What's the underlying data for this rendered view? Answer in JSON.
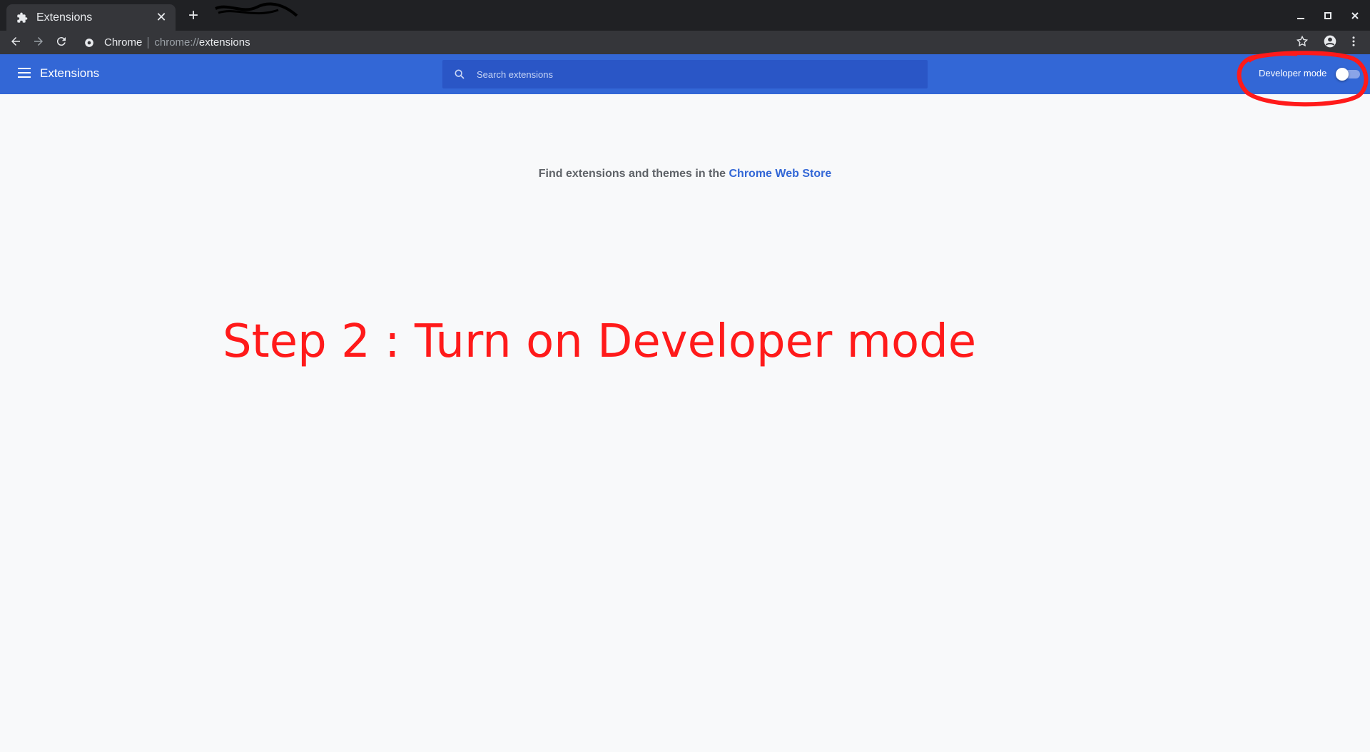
{
  "browser": {
    "tab": {
      "title": "Extensions",
      "icon": "puzzle-icon",
      "close_glyph": "✕"
    },
    "new_tab_glyph": "+",
    "window_controls": [
      "minimize-icon",
      "maximize-icon",
      "close-icon"
    ]
  },
  "toolbar": {
    "site_chip": "Chrome",
    "url_scheme": "chrome://",
    "url_path": "extensions"
  },
  "extensions_page": {
    "title": "Extensions",
    "search_placeholder": "Search extensions",
    "developer_mode_label": "Developer mode",
    "developer_mode_on": false,
    "store_prefix": "Find extensions and themes in the ",
    "store_link": "Chrome Web Store"
  },
  "annotation": {
    "text": "Step 2 :  Turn on Developer mode",
    "color": "#ff1a1a"
  },
  "colors": {
    "header_blue": "#3367d6",
    "search_blue": "#2a56c6",
    "page_bg": "#f8f9fa",
    "dark_frame": "#202124"
  }
}
